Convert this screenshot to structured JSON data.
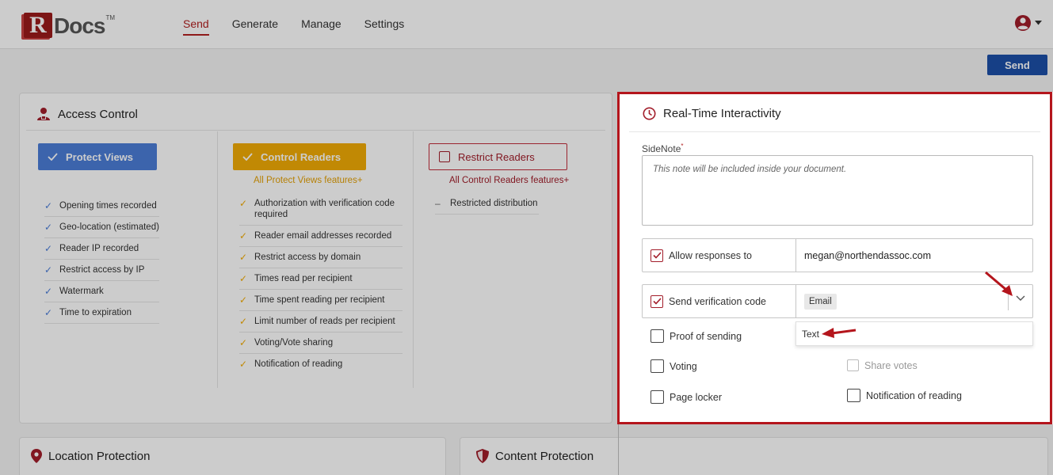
{
  "header": {
    "logo_r": "R",
    "logo_docs": "Docs",
    "logo_tm": "TM",
    "nav": [
      "Send",
      "Generate",
      "Manage",
      "Settings"
    ]
  },
  "toolbar": {
    "send_label": "Send"
  },
  "access_control": {
    "title": "Access Control",
    "tiers": [
      {
        "label": "Protect Views",
        "subhead": "",
        "features": [
          "Opening times recorded",
          "Geo-location (estimated)",
          "Reader IP recorded",
          "Restrict access by IP",
          "Watermark",
          "Time to expiration"
        ]
      },
      {
        "label": "Control Readers",
        "subhead": "All Protect Views features+",
        "features": [
          "Authorization with verification code required",
          "Reader email addresses recorded",
          "Restrict access by domain",
          "Times read per recipient",
          "Time spent reading per recipient",
          "Limit number of reads per recipient",
          "Voting/Vote sharing",
          "Notification of reading"
        ]
      },
      {
        "label": "Restrict Readers",
        "subhead": "All Control Readers features+",
        "features": [
          "Restricted distribution"
        ]
      }
    ]
  },
  "location_protection": {
    "title": "Location Protection"
  },
  "content_protection": {
    "title": "Content Protection"
  },
  "rti": {
    "title": "Real-Time Interactivity",
    "sidenote_label": "SideNote",
    "sidenote_required": "*",
    "sidenote_placeholder": "This note will be included inside your document.",
    "allow_responses_label": "Allow responses to",
    "allow_responses_value": "megan@northendassoc.com",
    "verification_label": "Send verification code",
    "verification_value": "Email",
    "dropdown_option": "Text",
    "options": {
      "proof_of_sending": "Proof of sending",
      "voting": "Voting",
      "share_votes": "Share votes",
      "page_locker": "Page locker",
      "notification_of_reading": "Notification of reading"
    }
  },
  "colors": {
    "brand_red": "#b22121",
    "send_blue": "#1c4fa8",
    "tier_blue": "#4c7ed8",
    "tier_yellow": "#f2ac06",
    "tier_red": "#a21d2a",
    "highlight_border": "#b4151c"
  },
  "icons": {
    "access_control": "user-lock-icon",
    "rti": "clock-icon",
    "location": "map-pin-icon",
    "content": "shield-icon",
    "user": "user-circle-icon"
  }
}
